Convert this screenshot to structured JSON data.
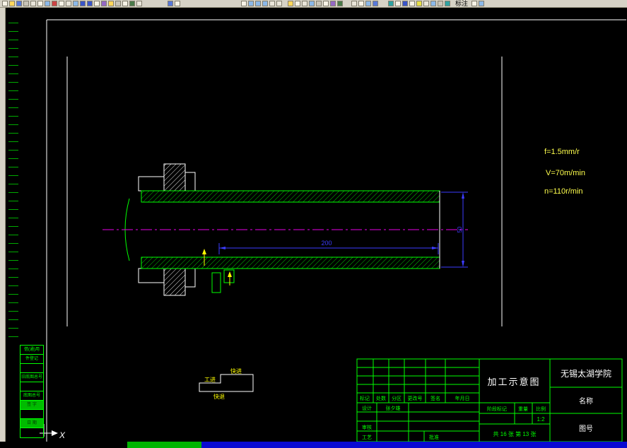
{
  "toolbar": {
    "dimension_label": "标注"
  },
  "canvas": {
    "cutting_params": {
      "feed": "f=1.5mm/r",
      "speed": "V=70m/min",
      "spindle": "n=110r/min"
    },
    "dimensions": {
      "length": "200",
      "diameter": "50"
    },
    "feed_diagram": {
      "work_feed": "工进",
      "rapid_advance": "快进",
      "rapid_return": "快退"
    },
    "ucs_x_label": "X"
  },
  "title_block": {
    "drawing_title": "加工示意图",
    "organization": "无锡太湖学院",
    "name_label": "名称",
    "drawing_number_label": "图号",
    "revision_headers": [
      "标记",
      "处数",
      "分区",
      "更改号",
      "签名",
      "年月日"
    ],
    "design_label": "设计",
    "designer_name": "张夕雄",
    "review_label": "审核",
    "process_label": "工艺",
    "approve_label": "批准",
    "stage_mark_label": "阶段标记",
    "weight_label": "重量",
    "scale_label": "比例",
    "scale_value": "1:2",
    "sheet_count": "共 16 张 第 13 张"
  },
  "side_table": {
    "rows": [
      {
        "label": "借(通)用"
      },
      {
        "label": "件登记"
      },
      {
        "label": ""
      },
      {
        "label": "旧底图总号"
      },
      {
        "label": ""
      },
      {
        "label": "底图总号"
      },
      {
        "label": "签 字"
      },
      {
        "label": ""
      },
      {
        "label": "日 期"
      },
      {
        "label": ""
      }
    ]
  },
  "colors": {
    "drawing_green": "#00ff00",
    "dimension_blue": "#3c3cff",
    "centerline_magenta": "#e800e8",
    "annotation_yellow": "#ffff4d",
    "canvas_black": "#000000",
    "toolbar_gray": "#d6d2c6",
    "statusbar_blue": "#0a0ad2",
    "statusbar_green": "#00b400"
  }
}
